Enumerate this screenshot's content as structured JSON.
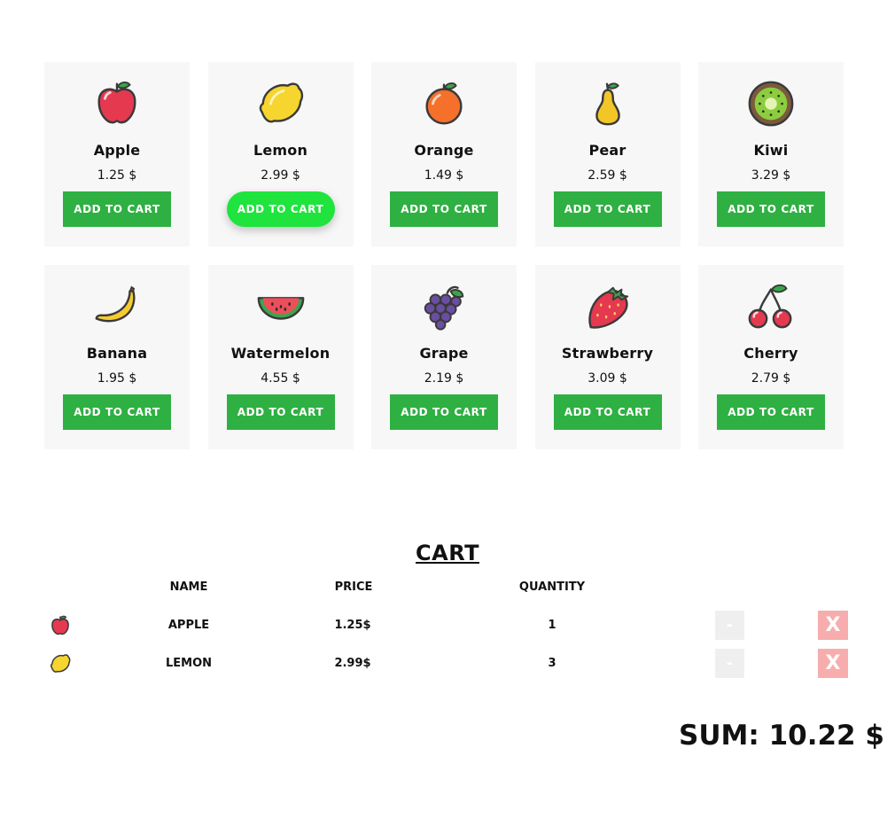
{
  "products": [
    {
      "name": "Apple",
      "price": "1.25 $",
      "button": "ADD TO CART",
      "icon": "apple-icon"
    },
    {
      "name": "Lemon",
      "price": "2.99 $",
      "button": "ADD TO CART",
      "icon": "lemon-icon"
    },
    {
      "name": "Orange",
      "price": "1.49 $",
      "button": "ADD TO CART",
      "icon": "orange-icon"
    },
    {
      "name": "Pear",
      "price": "2.59 $",
      "button": "ADD TO CART",
      "icon": "pear-icon"
    },
    {
      "name": "Kiwi",
      "price": "3.29 $",
      "button": "ADD TO CART",
      "icon": "kiwi-icon"
    },
    {
      "name": "Banana",
      "price": "1.95 $",
      "button": "ADD TO CART",
      "icon": "banana-icon"
    },
    {
      "name": "Watermelon",
      "price": "4.55 $",
      "button": "ADD TO CART",
      "icon": "watermelon-icon"
    },
    {
      "name": "Grape",
      "price": "2.19 $",
      "button": "ADD TO CART",
      "icon": "grape-icon"
    },
    {
      "name": "Strawberry",
      "price": "3.09 $",
      "button": "ADD TO CART",
      "icon": "strawberry-icon"
    },
    {
      "name": "Cherry",
      "price": "2.79 $",
      "button": "ADD TO CART",
      "icon": "cherry-icon"
    }
  ],
  "cart": {
    "title": "CART",
    "headers": {
      "name": "NAME",
      "price": "PRICE",
      "quantity": "QUANTITY"
    },
    "items": [
      {
        "name": "APPLE",
        "price": "1.25$",
        "quantity": "1",
        "minus": "-",
        "remove": "X",
        "icon": "apple-icon"
      },
      {
        "name": "LEMON",
        "price": "2.99$",
        "quantity": "3",
        "minus": "-",
        "remove": "X",
        "icon": "lemon-icon"
      }
    ],
    "sum": "SUM: 10.22 $"
  },
  "colors": {
    "button": "#2fb042",
    "button_hover": "#1ee43d",
    "card_bg": "#f7f7f7",
    "remove_bg": "#f7adad",
    "minus_bg": "#efefef"
  }
}
